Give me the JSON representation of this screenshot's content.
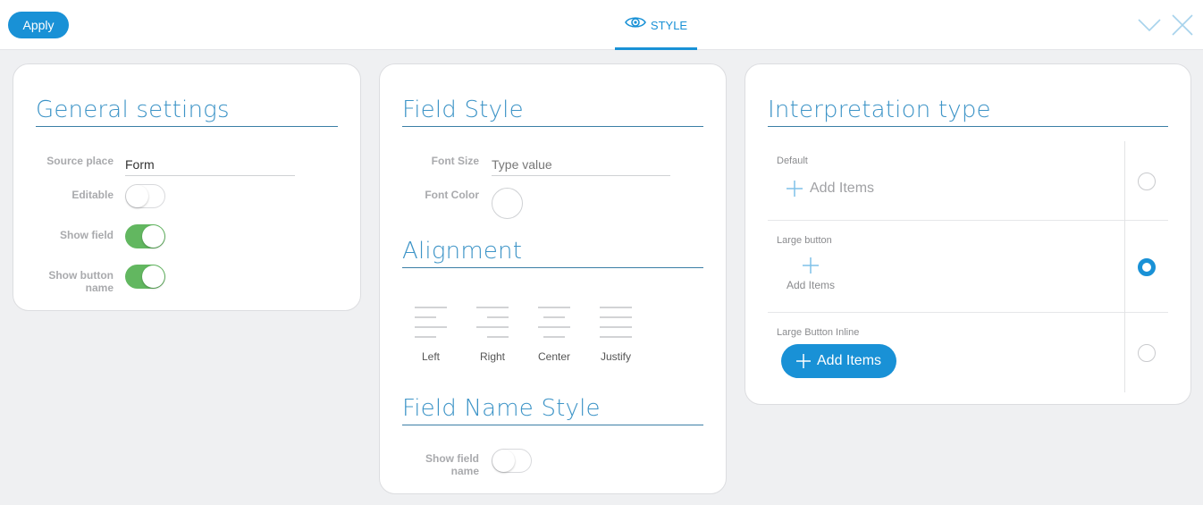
{
  "topbar": {
    "apply_label": "Apply",
    "tab_label": "STYLE",
    "tab_icon": "eye-icon",
    "right_icons": [
      "chevron-down-icon",
      "close-icon"
    ],
    "accent_color": "#1991d6"
  },
  "general": {
    "title": "General settings",
    "source_label": "Source place",
    "source_value": "Form",
    "editable_label": "Editable",
    "editable_on": false,
    "show_field_label": "Show field",
    "show_field_on": true,
    "show_button_label": "Show button name",
    "show_button_on": true,
    "toggle_on_color": "#62b760"
  },
  "field_style": {
    "title": "Field Style",
    "font_size_label": "Font Size",
    "font_size_placeholder": "Type value",
    "font_color_label": "Font Color"
  },
  "alignment": {
    "title": "Alignment",
    "options": [
      {
        "label": "Left",
        "icon": "align-left-icon"
      },
      {
        "label": "Right",
        "icon": "align-right-icon"
      },
      {
        "label": "Center",
        "icon": "align-center-icon"
      },
      {
        "label": "Justify",
        "icon": "align-justify-icon"
      }
    ]
  },
  "field_name_style": {
    "title": "Field Name Style",
    "show_field_name_label": "Show field name",
    "show_field_name_on": false
  },
  "interpretation": {
    "title": "Interpretation type",
    "add_items_label": "Add Items",
    "rows": [
      {
        "label": "Default",
        "selected": false
      },
      {
        "label": "Large button",
        "selected": true
      },
      {
        "label": "Large Button Inline",
        "selected": false
      }
    ]
  }
}
